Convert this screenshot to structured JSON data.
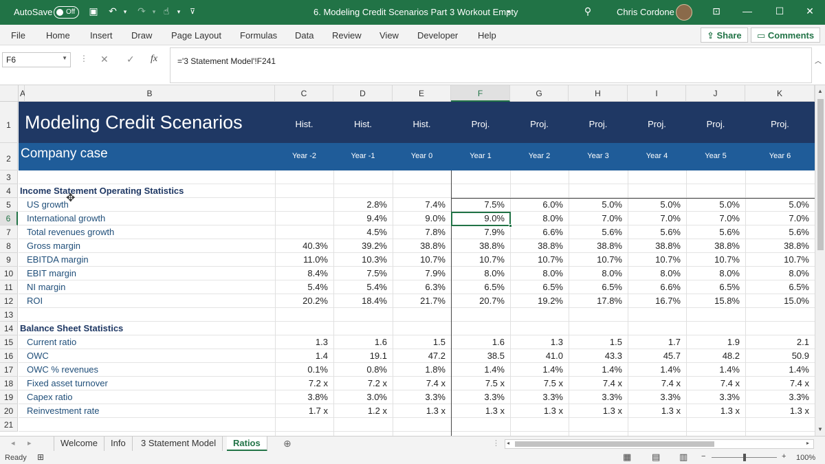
{
  "title_bar": {
    "autosave_label": "AutoSave",
    "autosave_state": "Off",
    "document_title": "6. Modeling Credit Scenarios Part 3 Workout Empty",
    "user_name": "Chris Cordone"
  },
  "menu": {
    "items": [
      "File",
      "Home",
      "Insert",
      "Draw",
      "Page Layout",
      "Formulas",
      "Data",
      "Review",
      "View",
      "Developer",
      "Help"
    ],
    "share_label": "Share",
    "comments_label": "Comments"
  },
  "formula_bar": {
    "name_box": "F6",
    "fx_label": "fx",
    "formula": "='3 Statement Model'!F241"
  },
  "grid": {
    "column_headers": [
      "A",
      "B",
      "C",
      "D",
      "E",
      "F",
      "G",
      "H",
      "I",
      "J",
      "K"
    ],
    "title": "Modeling Credit Scenarios",
    "subtitle": "Company case",
    "period_types": [
      "Hist.",
      "Hist.",
      "Hist.",
      "Proj.",
      "Proj.",
      "Proj.",
      "Proj.",
      "Proj.",
      "Proj."
    ],
    "period_years": [
      "Year -2",
      "Year -1",
      "Year 0",
      "Year 1",
      "Year 2",
      "Year 3",
      "Year 4",
      "Year 5",
      "Year 6"
    ],
    "income_section": "Income Statement Operating Statistics",
    "income_rows": [
      {
        "label": "US growth",
        "values": [
          "",
          "2.8%",
          "7.4%",
          "7.5%",
          "6.0%",
          "5.0%",
          "5.0%",
          "5.0%",
          "5.0%"
        ]
      },
      {
        "label": "International growth",
        "values": [
          "",
          "9.4%",
          "9.0%",
          "9.0%",
          "8.0%",
          "7.0%",
          "7.0%",
          "7.0%",
          "7.0%"
        ]
      },
      {
        "label": "Total revenues growth",
        "values": [
          "",
          "4.5%",
          "7.8%",
          "7.9%",
          "6.6%",
          "5.6%",
          "5.6%",
          "5.6%",
          "5.6%"
        ]
      },
      {
        "label": "Gross margin",
        "values": [
          "40.3%",
          "39.2%",
          "38.8%",
          "38.8%",
          "38.8%",
          "38.8%",
          "38.8%",
          "38.8%",
          "38.8%"
        ]
      },
      {
        "label": "EBITDA margin",
        "values": [
          "11.0%",
          "10.3%",
          "10.7%",
          "10.7%",
          "10.7%",
          "10.7%",
          "10.7%",
          "10.7%",
          "10.7%"
        ]
      },
      {
        "label": "EBIT margin",
        "values": [
          "8.4%",
          "7.5%",
          "7.9%",
          "8.0%",
          "8.0%",
          "8.0%",
          "8.0%",
          "8.0%",
          "8.0%"
        ]
      },
      {
        "label": "NI margin",
        "values": [
          "5.4%",
          "5.4%",
          "6.3%",
          "6.5%",
          "6.5%",
          "6.5%",
          "6.6%",
          "6.5%",
          "6.5%"
        ]
      },
      {
        "label": "ROI",
        "values": [
          "20.2%",
          "18.4%",
          "21.7%",
          "20.7%",
          "19.2%",
          "17.8%",
          "16.7%",
          "15.8%",
          "15.0%"
        ]
      }
    ],
    "balance_section": "Balance Sheet Statistics",
    "balance_rows": [
      {
        "label": "Current ratio",
        "values": [
          "1.3",
          "1.6",
          "1.5",
          "1.6",
          "1.3",
          "1.5",
          "1.7",
          "1.9",
          "2.1"
        ]
      },
      {
        "label": "OWC",
        "values": [
          "1.4",
          "19.1",
          "47.2",
          "38.5",
          "41.0",
          "43.3",
          "45.7",
          "48.2",
          "50.9"
        ]
      },
      {
        "label": "OWC % revenues",
        "values": [
          "0.1%",
          "0.8%",
          "1.8%",
          "1.4%",
          "1.4%",
          "1.4%",
          "1.4%",
          "1.4%",
          "1.4%"
        ]
      },
      {
        "label": "Fixed asset turnover",
        "values": [
          "7.2 x",
          "7.2 x",
          "7.4 x",
          "7.5 x",
          "7.5 x",
          "7.4 x",
          "7.4 x",
          "7.4 x",
          "7.4 x"
        ]
      },
      {
        "label": "Capex ratio",
        "values": [
          "3.8%",
          "3.0%",
          "3.3%",
          "3.3%",
          "3.3%",
          "3.3%",
          "3.3%",
          "3.3%",
          "3.3%"
        ]
      },
      {
        "label": "Reinvestment rate",
        "values": [
          "1.7 x",
          "1.2 x",
          "1.3 x",
          "1.3 x",
          "1.3 x",
          "1.3 x",
          "1.3 x",
          "1.3 x",
          "1.3 x"
        ]
      }
    ],
    "row_numbers": [
      "1",
      "2",
      "3",
      "4",
      "5",
      "6",
      "7",
      "8",
      "9",
      "10",
      "11",
      "12",
      "13",
      "14",
      "15",
      "16",
      "17",
      "18",
      "19",
      "20",
      "21"
    ]
  },
  "sheet_tabs": {
    "tabs": [
      "Welcome",
      "Info",
      "3 Statement Model",
      "Ratios"
    ],
    "active": "Ratios"
  },
  "status_bar": {
    "status": "Ready",
    "zoom": "100%",
    "zoom_level": 1.0
  },
  "colors": {
    "excel_green": "#217346",
    "banner_dark": "#1f3864",
    "banner_light": "#1f5c99",
    "label_blue": "#1f4e79"
  }
}
